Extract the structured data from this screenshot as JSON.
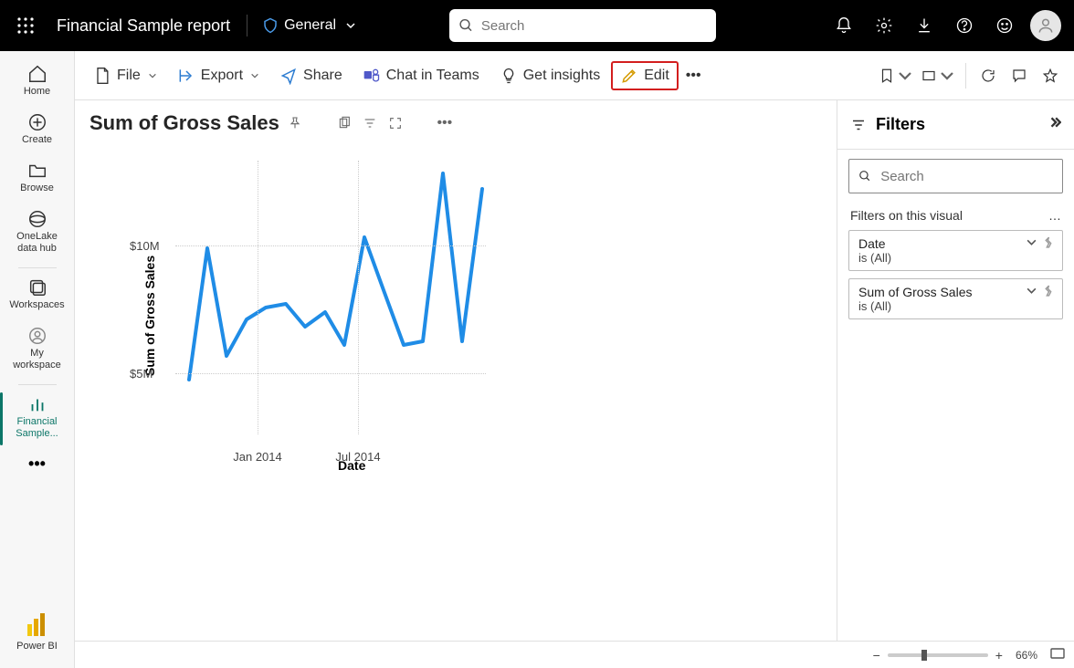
{
  "header": {
    "report_title": "Financial Sample report",
    "sensitivity_label": "General",
    "search_placeholder": "Search"
  },
  "leftnav": {
    "home": "Home",
    "create": "Create",
    "browse": "Browse",
    "onelake1": "OneLake",
    "onelake2": "data hub",
    "workspaces": "Workspaces",
    "my1": "My",
    "my2": "workspace",
    "financial1": "Financial",
    "financial2": "Sample...",
    "powerbi": "Power BI"
  },
  "ribbon": {
    "file": "File",
    "export": "Export",
    "share": "Share",
    "chat": "Chat in Teams",
    "insights": "Get insights",
    "edit": "Edit"
  },
  "visual": {
    "title": "Sum of Gross Sales",
    "ylabel": "Sum of Gross Sales",
    "xlabel": "Date",
    "ytick1": "$10M",
    "ytick2": "$5M",
    "xtick1": "Jan 2014",
    "xtick2": "Jul 2014"
  },
  "filters": {
    "title": "Filters",
    "search_placeholder": "Search",
    "section": "Filters on this visual",
    "card1_title": "Date",
    "card1_sub": "is (All)",
    "card2_title": "Sum of Gross Sales",
    "card2_sub": "is (All)"
  },
  "status": {
    "zoom": "66%"
  },
  "chart_data": {
    "type": "line",
    "title": "Sum of Gross Sales",
    "xlabel": "Date",
    "ylabel": "Sum of Gross Sales",
    "ylim": [
      4000000,
      13000000
    ],
    "x_ticks": [
      "Jan 2014",
      "Jul 2014"
    ],
    "series": [
      {
        "name": "Sum of Gross Sales",
        "x": [
          "Sep 2013",
          "Oct 2013",
          "Nov 2013",
          "Dec 2013",
          "Jan 2014",
          "Feb 2014",
          "Mar 2014",
          "Apr 2014",
          "May 2014",
          "Jun 2014",
          "Jul 2014",
          "Aug 2014",
          "Sep 2014",
          "Oct 2014",
          "Nov 2014",
          "Dec 2014"
        ],
        "values": [
          4800000,
          9900000,
          5700000,
          7100000,
          7600000,
          7700000,
          6800000,
          7400000,
          6100000,
          10300000,
          8200000,
          6100000,
          6200000,
          12800000,
          6200000,
          12200000
        ]
      }
    ]
  }
}
